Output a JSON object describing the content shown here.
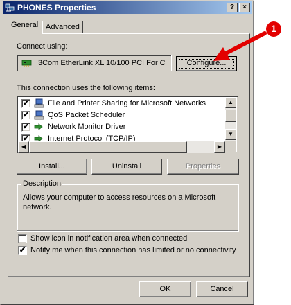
{
  "window": {
    "title": "PHONES Properties",
    "help_btn": "?",
    "close_btn": "×"
  },
  "tabs": [
    {
      "label": "General",
      "active": true
    },
    {
      "label": "Advanced",
      "active": false
    }
  ],
  "connect_using": {
    "label": "Connect using:",
    "adapter": "3Com EtherLink XL 10/100 PCI For C",
    "configure_button": "Configure..."
  },
  "items_section": {
    "label": "This connection uses the following items:",
    "items": [
      {
        "label": "File and Printer Sharing for Microsoft Networks",
        "checked": true,
        "icon": "network-service-icon"
      },
      {
        "label": "QoS Packet Scheduler",
        "checked": true,
        "icon": "network-service-icon"
      },
      {
        "label": "Network Monitor Driver",
        "checked": true,
        "icon": "protocol-icon"
      },
      {
        "label": "Internet Protocol (TCP/IP)",
        "checked": true,
        "icon": "protocol-icon"
      }
    ]
  },
  "action_buttons": {
    "install": "Install...",
    "uninstall": "Uninstall",
    "properties": "Properties"
  },
  "description": {
    "label": "Description",
    "text": "Allows your computer to access resources on a Microsoft network."
  },
  "options": {
    "show_icon": {
      "label": "Show icon in notification area when connected",
      "checked": false
    },
    "notify": {
      "label": "Notify me when this connection has limited or no connectivity",
      "checked": true
    }
  },
  "footer": {
    "ok": "OK",
    "cancel": "Cancel"
  },
  "annotation": {
    "number": "1"
  },
  "colors": {
    "title_start": "#0a246a",
    "title_end": "#a6caf0",
    "face": "#d4d0c8",
    "annotation": "#e30000"
  }
}
